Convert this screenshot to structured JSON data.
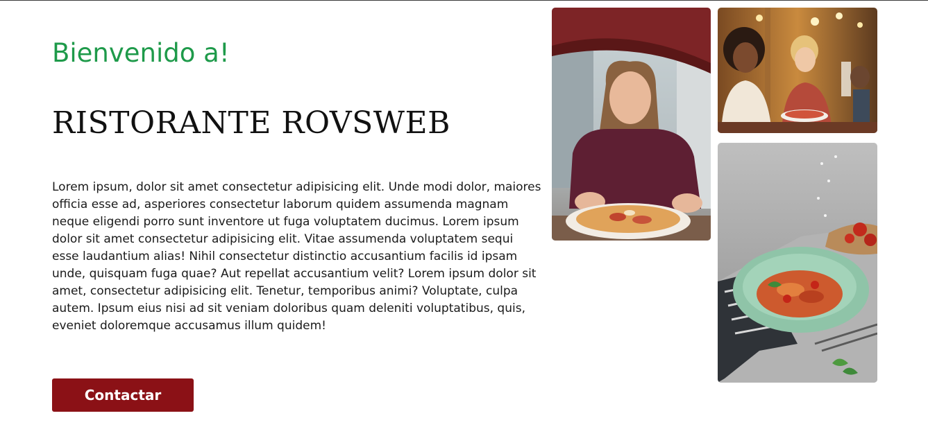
{
  "hero": {
    "welcome": "Bienvenido a!",
    "restaurant_name": "RISTORANTE ROVSWEB",
    "description": "Lorem ipsum, dolor sit amet consectetur adipisicing elit. Unde modi dolor, maiores officia esse ad, asperiores consectetur laborum quidem assumenda magnam neque eligendi porro sunt inventore ut fuga voluptatem ducimus. Lorem ipsum dolor sit amet consectetur adipisicing elit. Vitae assumenda voluptatem sequi esse laudantium alias! Nihil consectetur distinctio accusantium facilis id ipsam unde, quisquam fuga quae? Aut repellat accusantium velit? Lorem ipsum dolor sit amet, consectetur adipisicing elit. Tenetur, temporibus animi? Voluptate, culpa autem. Ipsum eius nisi ad sit veniam doloribus quam deleniti voluptatibus, quis, eveniet doloremque accusamus illum quidem!",
    "contact_label": "Contactar"
  },
  "gallery": [
    {
      "subject": "woman-with-pizza-photo"
    },
    {
      "subject": "friends-eating-pizza-photo"
    },
    {
      "subject": "pasta-bowl-photo"
    }
  ],
  "colors": {
    "welcome": "#1e9a4a",
    "button": "#8b1116",
    "heading": "#111111",
    "text": "#1a1a1a"
  }
}
